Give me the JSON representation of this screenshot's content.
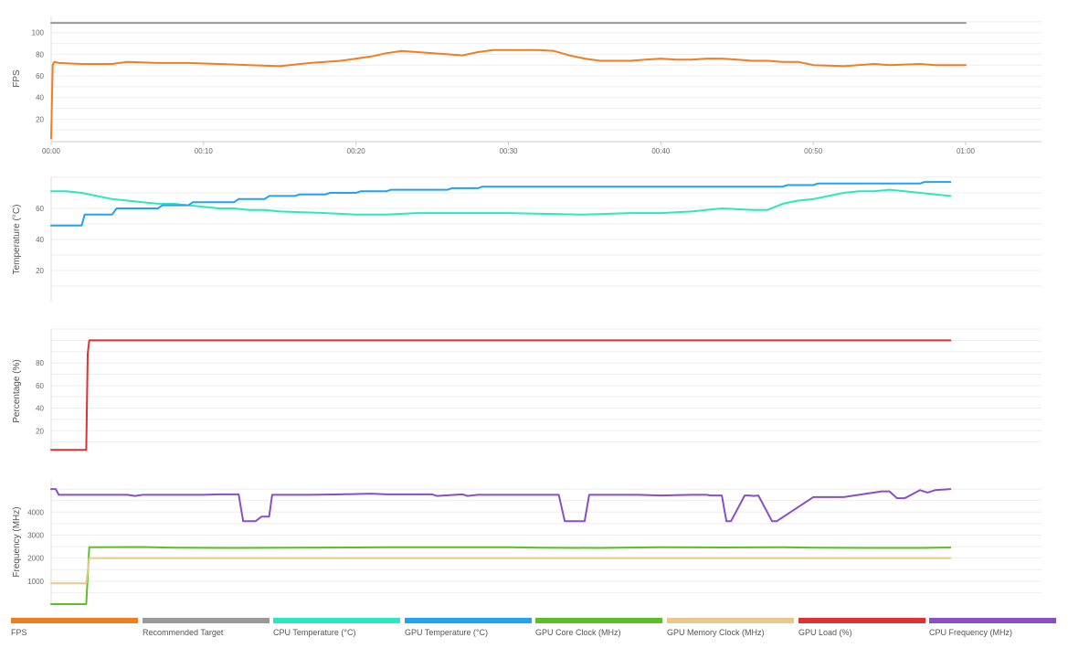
{
  "chart_data": [
    {
      "type": "line",
      "ylabel": "FPS",
      "ylim": [
        0,
        115
      ],
      "yticks": [
        "20",
        "40",
        "60",
        "80",
        "100"
      ],
      "ytick_values": [
        20,
        40,
        60,
        80,
        100
      ],
      "xticks": [
        "00:00",
        "00:10",
        "00:20",
        "00:30",
        "00:40",
        "00:50",
        "01:00"
      ],
      "xlim_minutes": [
        0,
        65
      ],
      "grid": true,
      "series": [
        {
          "name": "FPS",
          "color": "#f07e23",
          "x": [
            0,
            0.1,
            0.2,
            0.5,
            2,
            4,
            5,
            7,
            9,
            11,
            13,
            15,
            17,
            19,
            20,
            21,
            22,
            23,
            24,
            26,
            27,
            28,
            29,
            30,
            31,
            32,
            33,
            34,
            35,
            36,
            37,
            38,
            39,
            40,
            41,
            42,
            43,
            44,
            45,
            46,
            47,
            48,
            49,
            50,
            52,
            54,
            55,
            57,
            58,
            59,
            60
          ],
          "values": [
            2,
            70,
            73,
            72,
            71,
            71,
            73,
            72,
            72,
            71,
            70,
            69,
            72,
            74,
            76,
            78,
            81,
            83,
            82,
            80,
            79,
            82,
            84,
            84,
            84,
            84,
            83,
            79,
            76,
            74,
            74,
            74,
            75,
            76,
            75,
            75,
            76,
            76,
            75,
            74,
            74,
            73,
            73,
            70,
            69,
            71,
            70,
            71,
            70,
            70,
            70
          ]
        },
        {
          "name": "Recommended Target",
          "color": "#999999",
          "x": [
            0,
            60
          ],
          "values": [
            109,
            109
          ]
        }
      ]
    },
    {
      "type": "line",
      "ylabel": "Temperature (°C)",
      "ylim": [
        0,
        80
      ],
      "yticks": [
        "20",
        "40",
        "60"
      ],
      "ytick_values": [
        20,
        40,
        60
      ],
      "grid": true,
      "series": [
        {
          "name": "CPU Temperature (°C)",
          "color": "#2ce8c0",
          "x": [
            0,
            1,
            2,
            3,
            4,
            5,
            6,
            7,
            8,
            9,
            10,
            11,
            12,
            13,
            14,
            15,
            18,
            20,
            22,
            24,
            26,
            30,
            35,
            38,
            40,
            42,
            44,
            46,
            47,
            48,
            49,
            50,
            51,
            52,
            53,
            54,
            55,
            56,
            57,
            58,
            59
          ],
          "values": [
            71,
            71,
            70,
            68,
            66,
            65,
            64,
            63,
            63,
            62,
            61,
            60,
            60,
            59,
            59,
            58,
            57,
            56,
            56,
            57,
            57,
            57,
            56,
            57,
            57,
            58,
            60,
            59,
            59,
            63,
            65,
            66,
            68,
            70,
            71,
            71,
            72,
            71,
            70,
            69,
            68
          ]
        },
        {
          "name": "GPU Temperature (°C)",
          "color": "#22a3f2",
          "x": [
            0,
            2,
            2.2,
            4,
            4.3,
            7,
            7.3,
            9,
            9.3,
            12,
            12.3,
            14,
            14.3,
            16,
            16.3,
            18,
            18.3,
            20,
            20.3,
            22,
            22.3,
            24,
            24.3,
            26,
            26.3,
            28,
            28.3,
            30,
            30.3,
            32,
            32.3,
            34,
            34.3,
            36,
            36.3,
            44,
            44.3,
            48,
            48.3,
            50,
            50.3,
            57,
            57.3,
            59
          ],
          "values": [
            49,
            49,
            56,
            56,
            60,
            60,
            62,
            62,
            64,
            64,
            66,
            66,
            68,
            68,
            69,
            69,
            70,
            70,
            71,
            71,
            72,
            72,
            72,
            72,
            73,
            73,
            74,
            74,
            74,
            74,
            74,
            74,
            74,
            74,
            74,
            74,
            74,
            74,
            75,
            75,
            76,
            76,
            77,
            77
          ]
        }
      ]
    },
    {
      "type": "line",
      "ylabel": "Percentage (%)",
      "ylim": [
        0,
        110
      ],
      "yticks": [
        "20",
        "40",
        "60",
        "80"
      ],
      "ytick_values": [
        20,
        40,
        60,
        80
      ],
      "grid": true,
      "series": [
        {
          "name": "GPU Load (%)",
          "color": "#dc3232",
          "x": [
            0,
            2.3,
            2.4,
            2.5,
            59
          ],
          "values": [
            3,
            3,
            88,
            100,
            100
          ]
        }
      ]
    },
    {
      "type": "line",
      "ylabel": "Frequency (MHz)",
      "ylim": [
        0,
        5400
      ],
      "yticks": [
        "1000",
        "2000",
        "3000",
        "4000"
      ],
      "ytick_values": [
        1000,
        2000,
        3000,
        4000
      ],
      "grid": true,
      "series": [
        {
          "name": "GPU Core Clock (MHz)",
          "color": "#5cbf2a",
          "x": [
            0,
            2.3,
            2.5,
            6,
            8,
            12,
            16,
            20,
            22,
            26,
            30,
            32,
            36,
            40,
            44,
            48,
            50,
            54,
            57,
            59
          ],
          "values": [
            0,
            0,
            2470,
            2480,
            2450,
            2440,
            2450,
            2460,
            2470,
            2470,
            2470,
            2450,
            2440,
            2470,
            2460,
            2470,
            2450,
            2440,
            2440,
            2460
          ]
        },
        {
          "name": "GPU Memory Clock (MHz)",
          "color": "#e7c98a",
          "x": [
            0,
            2.3,
            2.5,
            59
          ],
          "values": [
            900,
            900,
            2000,
            2000
          ]
        },
        {
          "name": "CPU Frequency (MHz)",
          "color": "#8a4fc7",
          "x": [
            0,
            0.3,
            0.5,
            2,
            5,
            5.5,
            6,
            8,
            10,
            11,
            12,
            12.3,
            12.6,
            13.4,
            13.8,
            14.3,
            14.5,
            17,
            19,
            21,
            22,
            25,
            25.3,
            27,
            27.3,
            28,
            31,
            31.3,
            33.3,
            33.7,
            35,
            35.3,
            37,
            38.5,
            40,
            42,
            43,
            43.3,
            44,
            44.3,
            44.6,
            45.5,
            45.8,
            46.1,
            46.4,
            47.3,
            47.6,
            50,
            52,
            53,
            54,
            54.5,
            55,
            55.5,
            56,
            57,
            57.5,
            58,
            59
          ],
          "values": [
            5000,
            5000,
            4750,
            4750,
            4750,
            4700,
            4750,
            4750,
            4750,
            4770,
            4770,
            4770,
            3600,
            3600,
            3800,
            3800,
            4750,
            4750,
            4770,
            4800,
            4770,
            4770,
            4700,
            4770,
            4700,
            4750,
            4750,
            4750,
            4750,
            3600,
            3600,
            4750,
            4750,
            4750,
            4720,
            4750,
            4750,
            4720,
            4720,
            3600,
            3600,
            4720,
            4720,
            4700,
            4720,
            3600,
            3600,
            4650,
            4650,
            4750,
            4850,
            4900,
            4900,
            4600,
            4600,
            4950,
            4850,
            4950,
            5000
          ]
        }
      ]
    }
  ],
  "legend": [
    {
      "label": "FPS",
      "color": "#f07e23"
    },
    {
      "label": "Recommended Target",
      "color": "#999999"
    },
    {
      "label": "CPU Temperature (°C)",
      "color": "#2ce8c0"
    },
    {
      "label": "GPU Temperature (°C)",
      "color": "#22a3f2"
    },
    {
      "label": "GPU Core Clock (MHz)",
      "color": "#5cbf2a"
    },
    {
      "label": "GPU Memory Clock (MHz)",
      "color": "#e7c98a"
    },
    {
      "label": "GPU Load (%)",
      "color": "#dc3232"
    },
    {
      "label": "CPU Frequency (MHz)",
      "color": "#8a4fc7"
    }
  ]
}
